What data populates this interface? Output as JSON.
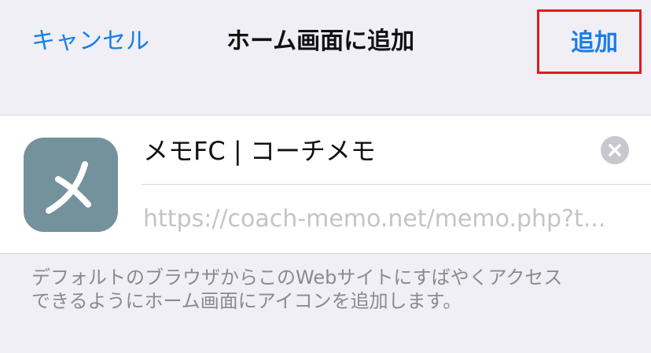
{
  "nav": {
    "cancel_label": "キャンセル",
    "title": "ホーム画面に追加",
    "add_label": "追加"
  },
  "shortcut": {
    "icon_glyph": "メ",
    "icon_color": "#73929b",
    "name": "メモFC | コーチメモ",
    "url": "https://coach-memo.net/memo.php?t..."
  },
  "footer": {
    "line1": "デフォルトのブラウザからこのWebサイトにすばやくアクセス",
    "line2": "できるようにホーム画面にアイコンを追加します。"
  },
  "colors": {
    "accent": "#1a7ee8",
    "highlight_box": "#e3191d",
    "background": "#f0eff5"
  }
}
